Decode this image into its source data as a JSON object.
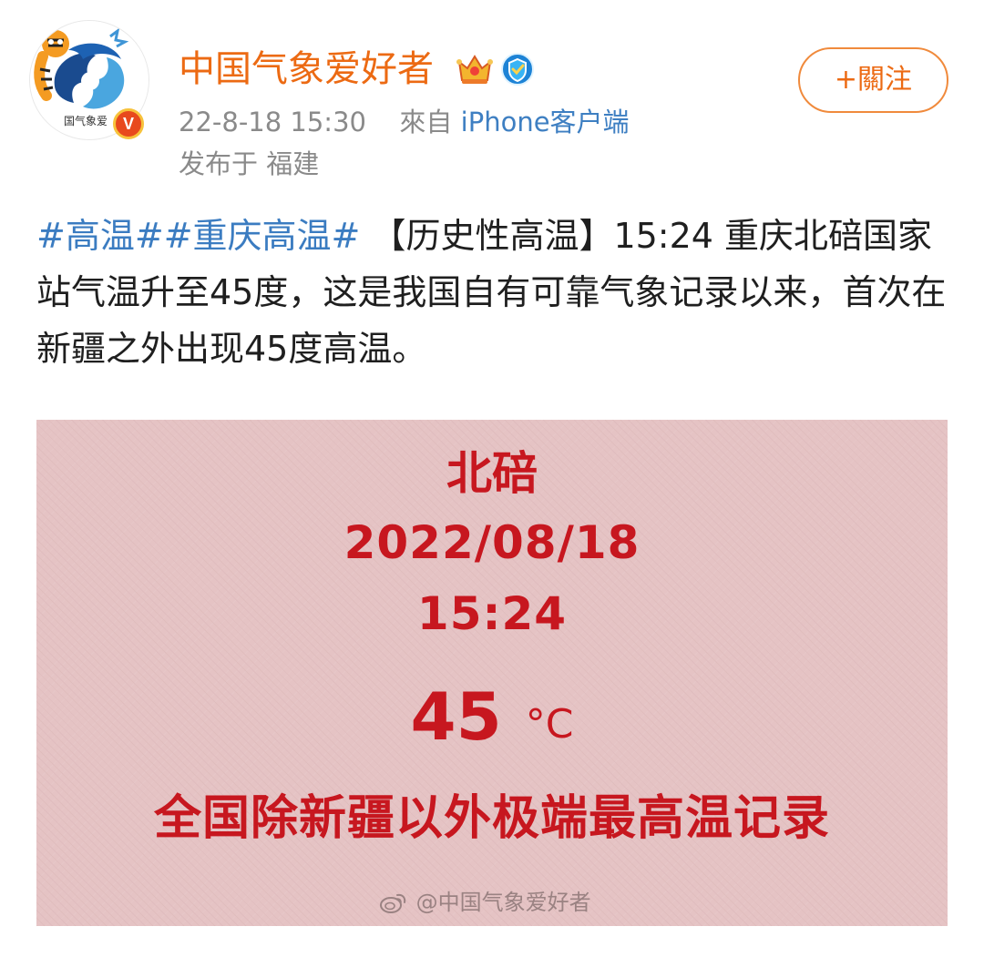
{
  "header": {
    "author_name": "中国气象爱好者",
    "avatar_caption": "国气象爱",
    "verified_mark": "V",
    "timestamp": "22-8-18 15:30",
    "source_prefix": "來自",
    "client_name": "iPhone客户端",
    "location": "发布于 福建",
    "follow_label": "+關注"
  },
  "post": {
    "hashtag_1": "#高温#",
    "hashtag_2": "#重庆高温#",
    "body_text": " 【历史性高温】15:24 重庆北碚国家站气温升至45度，这是我国自有可靠气象记录以来，首次在新疆之外出现45度高温。"
  },
  "image": {
    "place": "北碚",
    "date": "2022/08/18",
    "time": "15:24",
    "temperature_value": "45",
    "temperature_unit": "°C",
    "record_caption": "全国除新疆以外极端最高温记录",
    "watermark": "@中国气象爱好者",
    "background_color": "#e5c3c4",
    "text_color": "#c7171f"
  },
  "icons": {
    "avatar": "tiger-logo-avatar",
    "crown": "crown-icon",
    "badge": "blue-shield-badge-icon",
    "watermark": "weibo-icon"
  },
  "colors": {
    "author_name": "#ec6a13",
    "hashtag": "#3b7cc1",
    "follow_border": "#f08a3c"
  }
}
